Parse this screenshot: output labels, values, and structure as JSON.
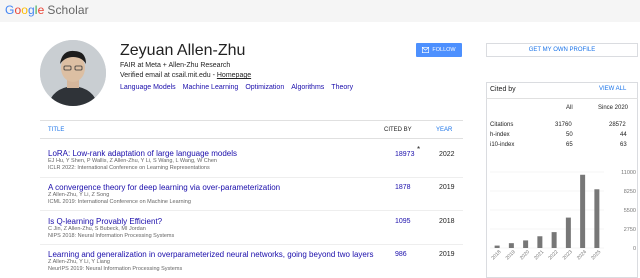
{
  "logo": {
    "google": [
      "G",
      "o",
      "o",
      "g",
      "l",
      "e"
    ],
    "scholar": "Scholar"
  },
  "profile": {
    "name": "Zeyuan Allen-Zhu",
    "affiliation": "FAIR at Meta + Allen-Zhu Research",
    "email_text": "Verified email at csail.mit.edu - ",
    "homepage": "Homepage",
    "topics": [
      "Language Models",
      "Machine Learning",
      "Optimization",
      "Algorithms",
      "Theory"
    ]
  },
  "buttons": {
    "follow": "FOLLOW",
    "my_profile": "GET MY OWN PROFILE"
  },
  "table": {
    "col_title": "TITLE",
    "col_cited": "CITED BY",
    "col_year": "YEAR",
    "rows": [
      {
        "title": "LoRA: Low-rank adaptation of large language models",
        "authors": "EJ Hu, Y Shen, P Wallis, Z Allen-Zhu, Y Li, S Wang, L Wang, W Chen",
        "venue": "ICLR 2022: International Conference on Learning Representations",
        "cited": "18973",
        "star": "*",
        "year": "2022"
      },
      {
        "title": "A convergence theory for deep learning via over-parameterization",
        "authors": "Z Allen-Zhu, Y Li, Z Song",
        "venue": "ICML 2019: International Conference on Machine Learning",
        "cited": "1878",
        "year": "2019"
      },
      {
        "title": "Is Q-learning Provably Efficient?",
        "authors": "C Jin, Z Allen-Zhu, S Bubeck, MI Jordan",
        "venue": "NIPS 2018: Neural Information Processing Systems",
        "cited": "1095",
        "year": "2018"
      },
      {
        "title": "Learning and generalization in overparameterized neural networks, going beyond two layers",
        "authors": "Z Allen-Zhu, Y Li, Y Liang",
        "venue": "NeurIPS 2019: Neural Information Processing Systems",
        "cited": "986",
        "year": "2019"
      }
    ]
  },
  "cited_by": {
    "title": "Cited by",
    "view_all": "VIEW ALL",
    "col_all": "All",
    "col_since": "Since 2020",
    "stats": [
      {
        "label": "Citations",
        "all": "31760",
        "since": "28572"
      },
      {
        "label": "h-index",
        "all": "50",
        "since": "44"
      },
      {
        "label": "i10-index",
        "all": "65",
        "since": "63"
      }
    ]
  },
  "chart_data": {
    "type": "bar",
    "categories": [
      "2018",
      "2019",
      "2020",
      "2021",
      "2022",
      "2023",
      "2024",
      "2025"
    ],
    "values": [
      350,
      700,
      1100,
      1700,
      2300,
      4400,
      10600,
      8500
    ],
    "yticks": [
      "11000",
      "8250",
      "5500",
      "2750",
      "0"
    ],
    "ylim": [
      0,
      11000
    ],
    "color": "#777777"
  }
}
